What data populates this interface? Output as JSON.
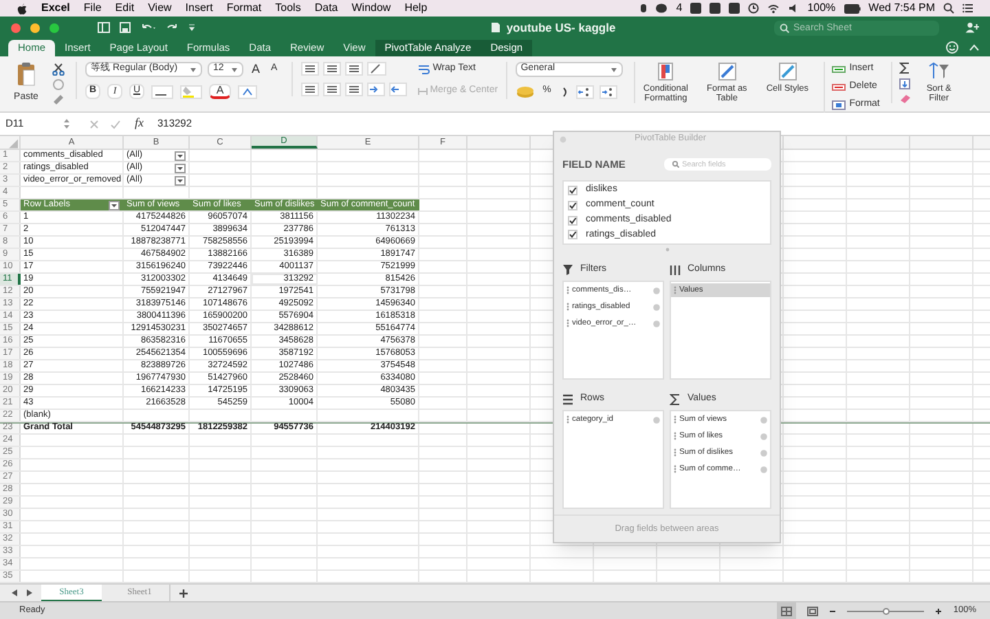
{
  "menu_bar": {
    "app": "Excel",
    "items": [
      "File",
      "Edit",
      "View",
      "Insert",
      "Format",
      "Tools",
      "Data",
      "Window",
      "Help"
    ],
    "badge": "4",
    "battery": "100%",
    "clock": "Wed 7:54 PM"
  },
  "title_bar": {
    "title": "youtube US- kaggle",
    "search_placeholder": "Search Sheet"
  },
  "ribbon_tabs": [
    {
      "label": "Home",
      "selected": true,
      "contextual": false
    },
    {
      "label": "Insert",
      "selected": false,
      "contextual": false
    },
    {
      "label": "Page Layout",
      "selected": false,
      "contextual": false
    },
    {
      "label": "Formulas",
      "selected": false,
      "contextual": false
    },
    {
      "label": "Data",
      "selected": false,
      "contextual": false
    },
    {
      "label": "Review",
      "selected": false,
      "contextual": false
    },
    {
      "label": "View",
      "selected": false,
      "contextual": false
    },
    {
      "label": "PivotTable Analyze",
      "selected": false,
      "contextual": true
    },
    {
      "label": "Design",
      "selected": false,
      "contextual": true
    }
  ],
  "ribbon": {
    "paste": "Paste",
    "font": "等线 Regular (Body)",
    "font_size": "12",
    "grow": "A",
    "shrink": "A",
    "style_buttons": [
      "B",
      "I",
      "U"
    ],
    "font_color": "A",
    "wrap_text": "Wrap Text",
    "merge": {
      "label": "Merge & Center",
      "disabled": true
    },
    "number_format": "General",
    "percent": "%",
    "format_buttons": [
      "Conditional Formatting",
      "Format as Table",
      "Cell Styles"
    ],
    "cell_buttons": [
      "Insert",
      "Delete",
      "Format"
    ],
    "sort": "Sort & Filter"
  },
  "formula_bar": {
    "cell": "D11",
    "function_label": "fx",
    "value": "313292"
  },
  "columns": [
    {
      "letter": "A",
      "selected": false
    },
    {
      "letter": "B",
      "selected": false
    },
    {
      "letter": "C",
      "selected": false
    },
    {
      "letter": "D",
      "selected": true
    },
    {
      "letter": "E",
      "selected": false
    },
    {
      "letter": "F",
      "selected": false
    }
  ],
  "rows": [
    {
      "number": "1",
      "selected": false,
      "kind": "filter",
      "cells": [
        "comments_disabled",
        "(All)"
      ]
    },
    {
      "number": "2",
      "selected": false,
      "kind": "filter",
      "cells": [
        "ratings_disabled",
        "(All)"
      ]
    },
    {
      "number": "3",
      "selected": false,
      "kind": "filter",
      "cells": [
        "video_error_or_removed",
        "(All)"
      ]
    },
    {
      "number": "4",
      "selected": false,
      "kind": "empty",
      "cells": []
    },
    {
      "number": "5",
      "selected": false,
      "kind": "header",
      "cells": [
        "Row Labels",
        "Sum of views",
        "Sum of likes",
        "Sum of dislikes",
        "Sum of comment_count"
      ]
    },
    {
      "number": "6",
      "selected": false,
      "kind": "data",
      "cells": [
        "1",
        "4175244826",
        "96057074",
        "3811156",
        "11302234"
      ]
    },
    {
      "number": "7",
      "selected": false,
      "kind": "data",
      "cells": [
        "2",
        "512047447",
        "3899634",
        "237786",
        "761313"
      ]
    },
    {
      "number": "8",
      "selected": false,
      "kind": "data",
      "cells": [
        "10",
        "18878238771",
        "758258556",
        "25193994",
        "64960669"
      ]
    },
    {
      "number": "9",
      "selected": false,
      "kind": "data",
      "cells": [
        "15",
        "467584902",
        "13882166",
        "316389",
        "1891747"
      ]
    },
    {
      "number": "10",
      "selected": false,
      "kind": "data",
      "cells": [
        "17",
        "3156196240",
        "73922446",
        "4001137",
        "7521999"
      ]
    },
    {
      "number": "11",
      "selected": true,
      "kind": "data",
      "cells": [
        "19",
        "312003302",
        "4134649",
        "313292",
        "815426"
      ]
    },
    {
      "number": "12",
      "selected": false,
      "kind": "data",
      "cells": [
        "20",
        "755921947",
        "27127967",
        "1972541",
        "5731798"
      ]
    },
    {
      "number": "13",
      "selected": false,
      "kind": "data",
      "cells": [
        "22",
        "3183975146",
        "107148676",
        "4925092",
        "14596340"
      ]
    },
    {
      "number": "14",
      "selected": false,
      "kind": "data",
      "cells": [
        "23",
        "3800411396",
        "165900200",
        "5576904",
        "16185318"
      ]
    },
    {
      "number": "15",
      "selected": false,
      "kind": "data",
      "cells": [
        "24",
        "12914530231",
        "350274657",
        "34288612",
        "55164774"
      ]
    },
    {
      "number": "16",
      "selected": false,
      "kind": "data",
      "cells": [
        "25",
        "863582316",
        "11670655",
        "3458628",
        "4756378"
      ]
    },
    {
      "number": "17",
      "selected": false,
      "kind": "data",
      "cells": [
        "26",
        "2545621354",
        "100559696",
        "3587192",
        "15768053"
      ]
    },
    {
      "number": "18",
      "selected": false,
      "kind": "data",
      "cells": [
        "27",
        "823889726",
        "32724592",
        "1027486",
        "3754548"
      ]
    },
    {
      "number": "19",
      "selected": false,
      "kind": "data",
      "cells": [
        "28",
        "1967747930",
        "51427960",
        "2528460",
        "6334080"
      ]
    },
    {
      "number": "20",
      "selected": false,
      "kind": "data",
      "cells": [
        "29",
        "166214233",
        "14725195",
        "3309063",
        "4803435"
      ]
    },
    {
      "number": "21",
      "selected": false,
      "kind": "data",
      "cells": [
        "43",
        "21663528",
        "545259",
        "10004",
        "55080"
      ]
    },
    {
      "number": "22",
      "selected": false,
      "kind": "data",
      "cells": [
        "(blank)"
      ]
    },
    {
      "number": "23",
      "selected": false,
      "kind": "total",
      "cells": [
        "Grand Total",
        "54544873295",
        "1812259382",
        "94557736",
        "214403192"
      ]
    },
    {
      "number": "24",
      "selected": false,
      "kind": "empty",
      "cells": []
    },
    {
      "number": "25",
      "selected": false,
      "kind": "empty",
      "cells": []
    },
    {
      "number": "26",
      "selected": false,
      "kind": "empty",
      "cells": []
    },
    {
      "number": "27",
      "selected": false,
      "kind": "empty",
      "cells": []
    },
    {
      "number": "28",
      "selected": false,
      "kind": "empty",
      "cells": []
    },
    {
      "number": "29",
      "selected": false,
      "kind": "empty",
      "cells": []
    },
    {
      "number": "30",
      "selected": false,
      "kind": "empty",
      "cells": []
    },
    {
      "number": "31",
      "selected": false,
      "kind": "empty",
      "cells": []
    },
    {
      "number": "32",
      "selected": false,
      "kind": "empty",
      "cells": []
    },
    {
      "number": "33",
      "selected": false,
      "kind": "empty",
      "cells": []
    },
    {
      "number": "34",
      "selected": false,
      "kind": "empty",
      "cells": []
    },
    {
      "number": "35",
      "selected": false,
      "kind": "empty",
      "cells": []
    }
  ],
  "sheet_tabs": [
    {
      "label": "Sheet3",
      "selected": true
    },
    {
      "label": "Sheet1",
      "selected": false
    }
  ],
  "status_bar": {
    "status": "Ready",
    "zoom": "100%",
    "level": 0.5
  },
  "pivot_builder": {
    "title": "PivotTable Builder",
    "field_header": "FIELD NAME",
    "search_placeholder": "Search fields",
    "fields": [
      {
        "name": "dislikes",
        "checked": true
      },
      {
        "name": "comment_count",
        "checked": true
      },
      {
        "name": "comments_disabled",
        "checked": true
      },
      {
        "name": "ratings_disabled",
        "checked": true
      }
    ],
    "filters": {
      "label": "Filters",
      "items": [
        {
          "label": "comments_dis…",
          "selected": false
        },
        {
          "label": "ratings_disabled",
          "selected": false
        },
        {
          "label": "video_error_or_…",
          "selected": false
        }
      ]
    },
    "columns": {
      "label": "Columns",
      "items": [
        {
          "label": "Values",
          "selected": true
        }
      ]
    },
    "rows": {
      "label": "Rows",
      "items": [
        {
          "label": "category_id",
          "selected": false
        }
      ]
    },
    "values": {
      "label": "Values",
      "items": [
        {
          "label": "Sum of views",
          "selected": false
        },
        {
          "label": "Sum of likes",
          "selected": false
        },
        {
          "label": "Sum of dislikes",
          "selected": false
        },
        {
          "label": "Sum of comme…",
          "selected": false
        }
      ]
    },
    "hint": "Drag fields between areas"
  }
}
